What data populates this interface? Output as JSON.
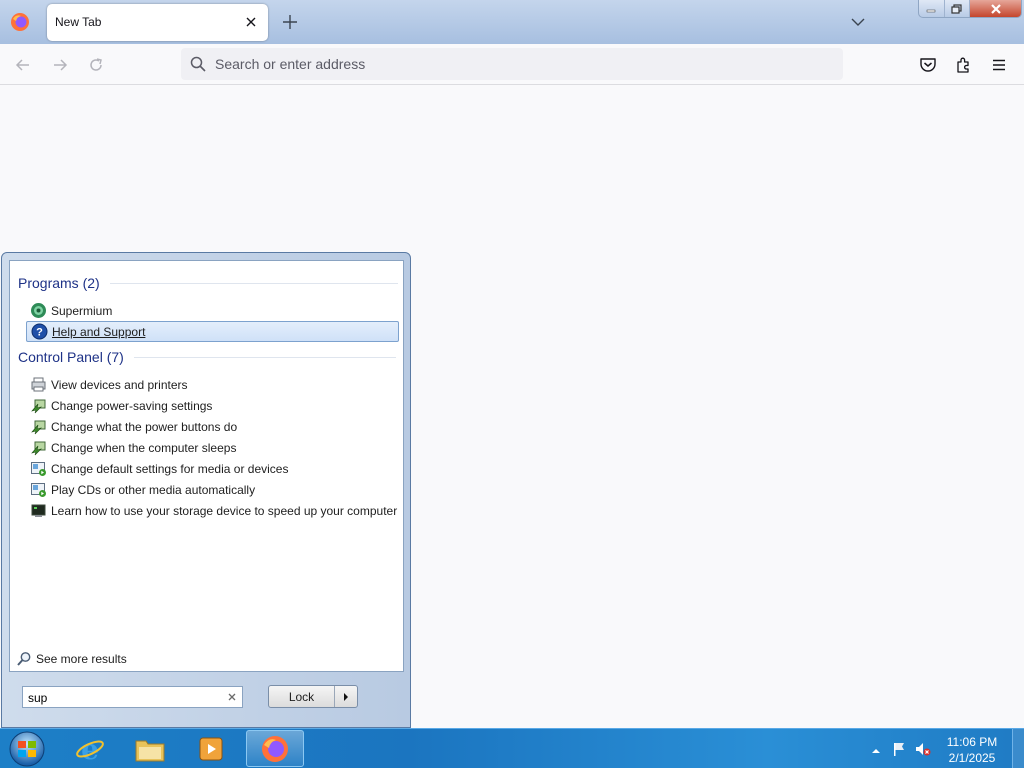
{
  "browser": {
    "tab": {
      "title": "New Tab"
    },
    "urlbar": {
      "placeholder": "Search or enter address"
    }
  },
  "start_menu": {
    "groups": [
      {
        "title": "Programs (2)",
        "items": [
          {
            "label": "Supermium",
            "icon": "supermium-icon"
          },
          {
            "label": "Help and Support",
            "icon": "help-icon",
            "selected": true
          }
        ]
      },
      {
        "title": "Control Panel (7)",
        "items": [
          {
            "label": "View devices and printers",
            "icon": "devices-printers-icon"
          },
          {
            "label": "Change power-saving settings",
            "icon": "power-options-icon"
          },
          {
            "label": "Change what the power buttons do",
            "icon": "power-options-icon"
          },
          {
            "label": "Change when the computer sleeps",
            "icon": "power-options-icon"
          },
          {
            "label": "Change default settings for media or devices",
            "icon": "autoplay-icon"
          },
          {
            "label": "Play CDs or other media automatically",
            "icon": "autoplay-icon"
          },
          {
            "label": "Learn how to use your storage device to speed up your computer",
            "icon": "readyboost-icon"
          }
        ]
      }
    ],
    "see_more": "See more results",
    "search": {
      "value": "sup"
    },
    "lock_label": "Lock"
  },
  "taskbar": {
    "apps": [
      "internet-explorer",
      "file-explorer",
      "media-player",
      "firefox"
    ],
    "active_app": "firefox",
    "clock": {
      "time": "11:06 PM",
      "date": "2/1/2025"
    }
  },
  "colors": {
    "accent": "#1e3287",
    "taskbar": "#1d7fc7",
    "tab_bar": "#b6cbe7"
  }
}
